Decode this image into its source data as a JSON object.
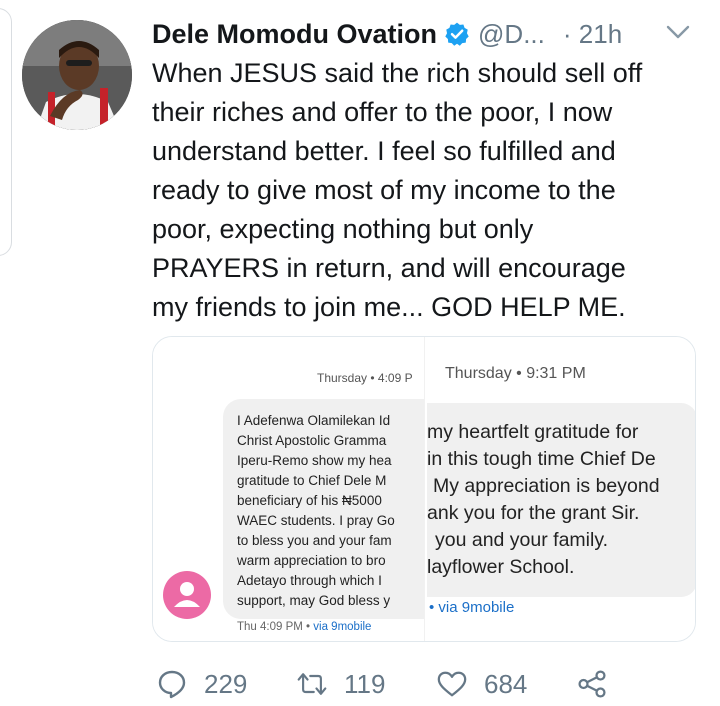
{
  "tweet": {
    "author_name": "Dele Momodu Ovation",
    "handle": "@D...",
    "time_sep": "·",
    "time": "21h",
    "text_lines": [
      "When JESUS said the rich should sell off",
      "their riches and offer to the poor, I now",
      "understand better. I feel so fulfilled and",
      "ready to give most of my income to the",
      "poor, expecting nothing but only",
      "PRAYERS in return, and will encourage",
      "my friends to join me... GOD HELP ME."
    ],
    "accent": "#1da1f2"
  },
  "media": {
    "screenshot1": {
      "time": "Thursday • 4:09 P",
      "lines": [
        "I Adefenwa Olamilekan Id",
        "Christ Apostolic Gramma",
        "Iperu-Remo show my hea",
        "gratitude to Chief Dele M",
        "beneficiary of his ₦5000",
        "WAEC students. I pray Go",
        "to bless you and your fam",
        "warm appreciation to bro",
        "Adetayo through which I",
        "support, may God bless y"
      ],
      "footer_time": "Thu 4:09 PM",
      "footer_sep": "•",
      "footer_via": "via 9mobile",
      "avatar_color": "#ec6aa5"
    },
    "screenshot2": {
      "time": "Thursday • 9:31 PM",
      "lines": [
        "my heartfelt gratitude for",
        "in this tough time Chief De",
        "My appreciation is beyond",
        "ank you for the grant Sir.",
        "you and your family.",
        "layflower School."
      ],
      "footer": "• via 9mobile"
    }
  },
  "actions": {
    "replies": "229",
    "retweets": "119",
    "likes": "684"
  }
}
